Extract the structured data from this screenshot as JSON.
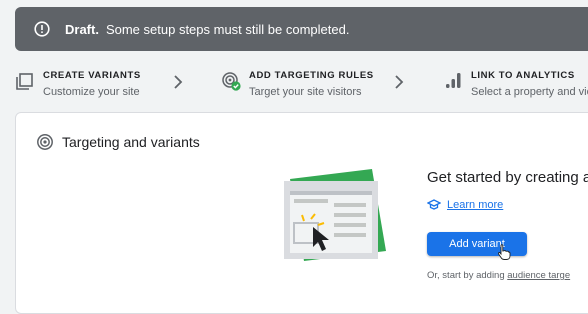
{
  "banner": {
    "status": "Draft.",
    "message": "Some setup steps must still be completed."
  },
  "steps": [
    {
      "title": "CREATE VARIANTS",
      "subtitle": "Customize your site",
      "icon": "copy-icon"
    },
    {
      "title": "ADD TARGETING RULES",
      "subtitle": "Target your site visitors",
      "icon": "targeting-done-icon"
    },
    {
      "title": "LINK TO ANALYTICS",
      "subtitle": "Select a property and view",
      "icon": "analytics-icon"
    }
  ],
  "card": {
    "title": "Targeting and variants",
    "headline": "Get started by creating a",
    "learn_more": "Learn more",
    "add_variant": "Add variant",
    "alt_prefix": "Or, start by adding",
    "alt_link": "audience targe"
  },
  "colors": {
    "banner_bg": "#5f6368",
    "accent": "#1a73e8",
    "success": "#34a853",
    "illustration_green": "#34a853",
    "highlight_yellow": "#fbbc04"
  }
}
